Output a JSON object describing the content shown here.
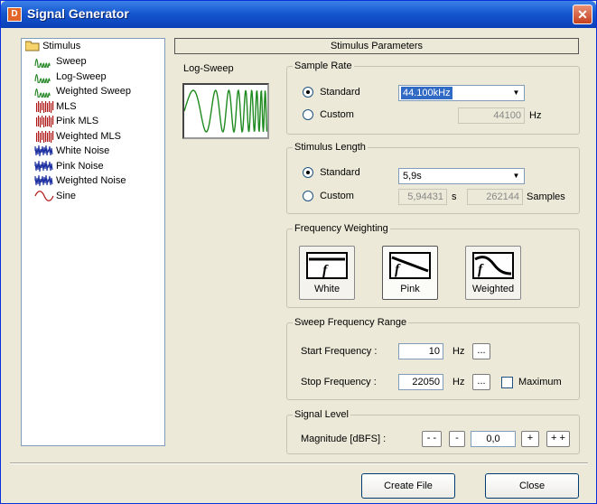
{
  "window": {
    "title": "Signal Generator"
  },
  "tree": {
    "root_label": "Stimulus",
    "items": [
      {
        "label": "Sweep",
        "icon": "sweep-icon",
        "color": "#2a8a2a"
      },
      {
        "label": "Log-Sweep",
        "icon": "log-sweep-icon",
        "color": "#2a8a2a"
      },
      {
        "label": "Weighted Sweep",
        "icon": "weighted-sweep-icon",
        "color": "#2a8a2a"
      },
      {
        "label": "MLS",
        "icon": "mls-icon",
        "color": "#b01818"
      },
      {
        "label": "Pink MLS",
        "icon": "pink-mls-icon",
        "color": "#b01818"
      },
      {
        "label": "Weighted MLS",
        "icon": "weighted-mls-icon",
        "color": "#b01818"
      },
      {
        "label": "White Noise",
        "icon": "white-noise-icon",
        "color": "#1a2ea0"
      },
      {
        "label": "Pink Noise",
        "icon": "pink-noise-icon",
        "color": "#1a2ea0"
      },
      {
        "label": "Weighted Noise",
        "icon": "weighted-noise-icon",
        "color": "#1a2ea0"
      },
      {
        "label": "Sine",
        "icon": "sine-icon",
        "color": "#b01818"
      }
    ]
  },
  "panel": {
    "header": "Stimulus Parameters",
    "stimulus_name": "Log-Sweep"
  },
  "sample_rate": {
    "legend": "Sample Rate",
    "standard_label": "Standard",
    "standard_value": "44.100kHz",
    "custom_label": "Custom",
    "custom_value": "44100",
    "unit": "Hz",
    "selected": "standard"
  },
  "stimulus_length": {
    "legend": "Stimulus Length",
    "standard_label": "Standard",
    "standard_value": "5,9s",
    "custom_label": "Custom",
    "seconds_value": "5,94431",
    "seconds_unit": "s",
    "samples_value": "262144",
    "samples_unit": "Samples"
  },
  "weighting": {
    "legend": "Frequency Weighting",
    "options": [
      {
        "label": "White",
        "icon": "white-weighting-icon"
      },
      {
        "label": "Pink",
        "icon": "pink-weighting-icon",
        "selected": true
      },
      {
        "label": "Weighted",
        "icon": "weighted-weighting-icon"
      }
    ]
  },
  "sweep_range": {
    "legend": "Sweep Frequency Range",
    "start_label": "Start Frequency :",
    "start_value": "10",
    "stop_label": "Stop Frequency :",
    "stop_value": "22050",
    "unit": "Hz",
    "browse_label": "...",
    "maximum_label": "Maximum"
  },
  "signal_level": {
    "legend": "Signal Level",
    "magnitude_label": "Magnitude [dBFS] :",
    "dec_big": "- -",
    "dec": "-",
    "value": "0,0",
    "inc": "+",
    "inc_big": "+ +"
  },
  "buttons": {
    "create_file": "Create File",
    "close": "Close"
  },
  "colors": {
    "titlebar": "#0a3fb6",
    "selection": "#316ac5"
  }
}
